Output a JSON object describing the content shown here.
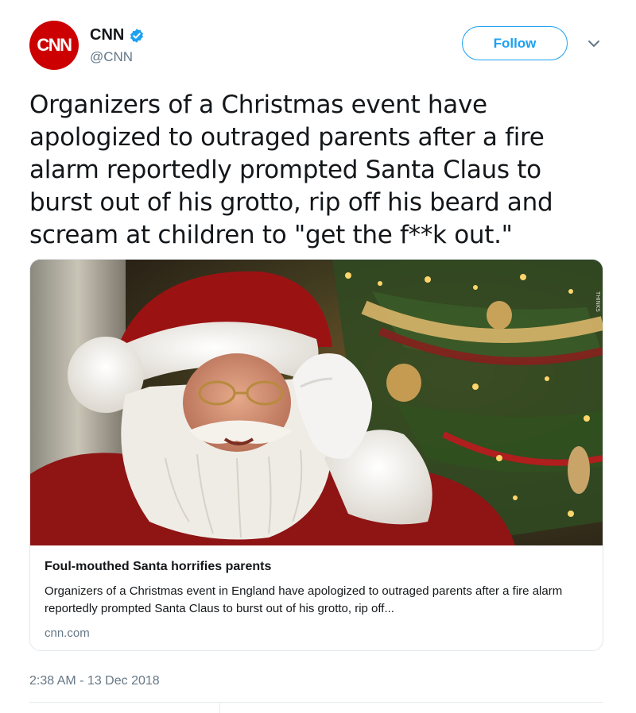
{
  "account": {
    "avatar_text": "CNN",
    "name": "CNN",
    "handle": "@CNN",
    "verified": true,
    "brand_color": "#cc0000"
  },
  "actions": {
    "follow_label": "Follow"
  },
  "tweet": {
    "text": "Organizers of a Christmas event have apologized to outraged parents after a fire alarm reportedly prompted Santa Claus to burst out of his grotto, rip off his beard and scream at children to \"get the f**k out.\"",
    "timestamp": "2:38 AM - 13 Dec 2018"
  },
  "card": {
    "image_icon": "santa-claus-photo",
    "title": "Foul-mouthed Santa horrifies parents",
    "description": "Organizers of a Christmas event in England have apologized to outraged parents after a fire alarm reportedly prompted Santa Claus to burst out of his grotto, rip off...",
    "domain": "cnn.com"
  },
  "colors": {
    "accent": "#1da1f2",
    "secondary_text": "#657786",
    "border": "#e1e8ed"
  }
}
